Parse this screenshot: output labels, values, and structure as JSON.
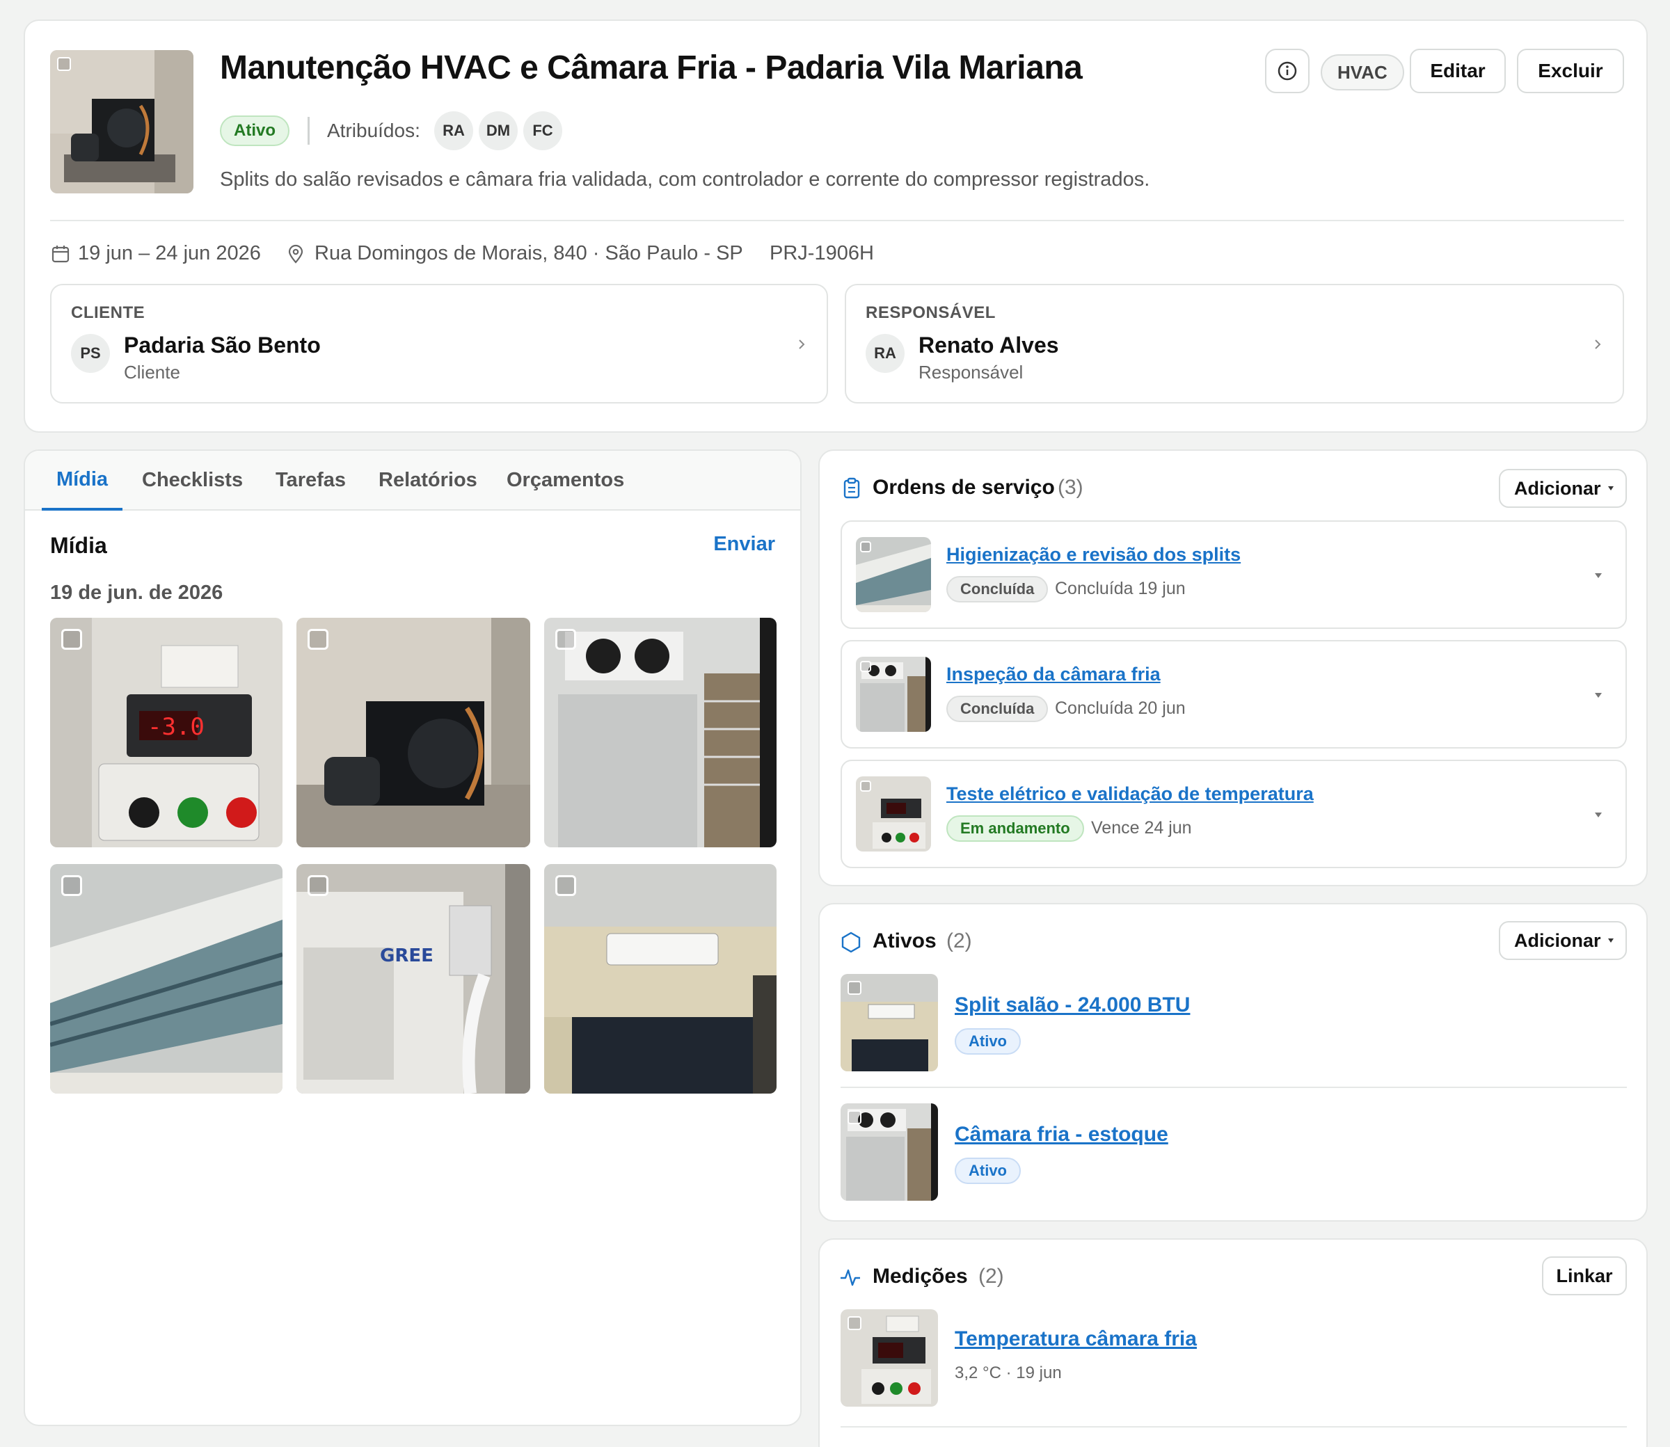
{
  "project": {
    "title": "Manutenção HVAC e Câmara Fria - Padaria Vila Mariana",
    "status": "Ativo",
    "assigned_label": "Atribuídos:",
    "assignees": [
      "RA",
      "DM",
      "FC"
    ],
    "description": "Splits do salão revisados e câmara fria validada, com controlador e corrente do compressor registrados.",
    "tag": "HVAC",
    "edit_label": "Editar",
    "delete_label": "Excluir",
    "dates": "19 jun – 24 jun 2026",
    "address": "Rua Domingos de Morais, 840 · São Paulo - SP",
    "code": "PRJ-1906H"
  },
  "client": {
    "section": "CLIENTE",
    "initials": "PS",
    "name": "Padaria São Bento",
    "role": "Cliente"
  },
  "responsible": {
    "section": "RESPONSÁVEL",
    "initials": "RA",
    "name": "Renato Alves",
    "role": "Responsável"
  },
  "tabs": [
    "Mídia",
    "Checklists",
    "Tarefas",
    "Relatórios",
    "Orçamentos"
  ],
  "media": {
    "title": "Mídia",
    "upload_label": "Enviar",
    "date_group": "19 de jun. de 2026",
    "images": [
      "controller-panel",
      "condensing-unit",
      "cold-room",
      "split-open",
      "outdoor-unit",
      "split-wall"
    ]
  },
  "orders": {
    "title": "Ordens de serviço",
    "count": "(3)",
    "add_label": "Adicionar",
    "items": [
      {
        "title": "Higienização e revisão dos splits",
        "status": "Concluída",
        "meta": "Concluída 19 jun"
      },
      {
        "title": "Inspeção da câmara fria",
        "status": "Concluída",
        "meta": "Concluída 20 jun"
      },
      {
        "title": "Teste elétrico e validação de temperatura",
        "status": "Em andamento",
        "meta": "Vence 24 jun"
      }
    ]
  },
  "assets": {
    "title": "Ativos",
    "count": "(2)",
    "add_label": "Adicionar",
    "items": [
      {
        "title": "Split salão - 24.000 BTU",
        "status": "Ativo"
      },
      {
        "title": "Câmara fria - estoque",
        "status": "Ativo"
      }
    ]
  },
  "measurements": {
    "title": "Medições",
    "count": "(2)",
    "link_label": "Linkar",
    "items": [
      {
        "title": "Temperatura câmara fria",
        "meta": "3,2 °C · 19 jun"
      }
    ]
  },
  "colors": {
    "accent": "#1a73c8",
    "active_green_bg": "#e6f6e6",
    "active_green_text": "#237a23",
    "done_gray_bg": "#eeefee",
    "asset_blue_bg": "#e9f2fd"
  }
}
